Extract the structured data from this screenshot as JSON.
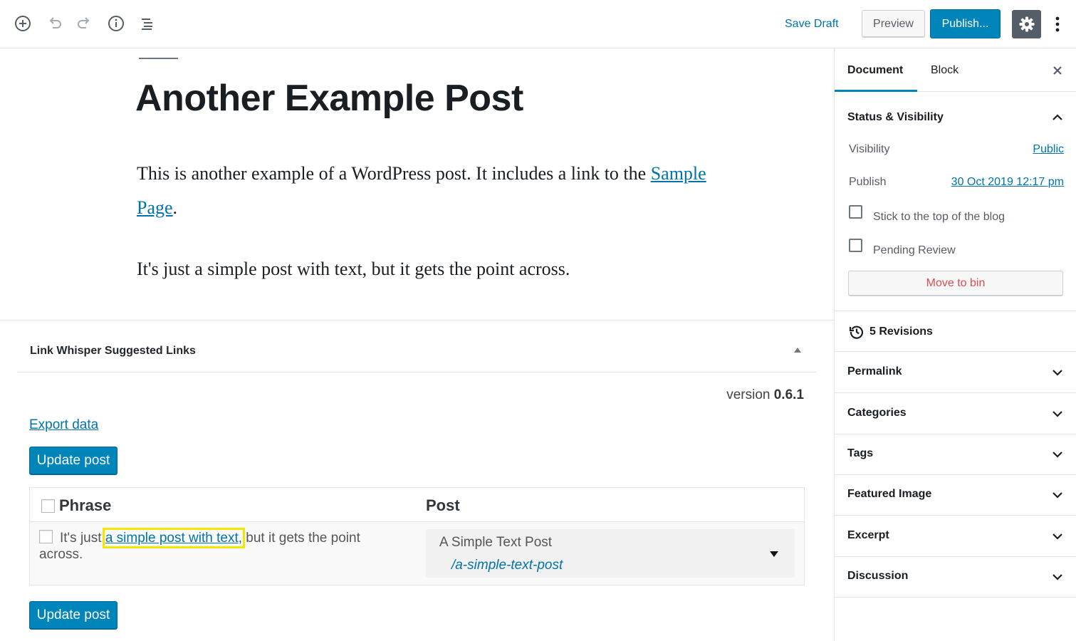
{
  "toolbar": {
    "save_draft": "Save Draft",
    "preview": "Preview",
    "publish": "Publish...",
    "icons": [
      "add-block-icon",
      "undo-icon",
      "redo-icon",
      "info-icon",
      "block-navigation-icon",
      "gear-icon",
      "more-menu-icon"
    ]
  },
  "editor": {
    "title": "Another Example Post",
    "para1_before": "This is another example of a WordPress post. It includes a link to the ",
    "para1_link": "Sample Page",
    "para1_after": ".",
    "para2": "It's just a simple post with text, but it gets the point across."
  },
  "link_whisper": {
    "title": "Link Whisper Suggested Links",
    "version_label": "version ",
    "version_number": "0.6.1",
    "export": "Export data",
    "update_button": "Update post",
    "columns": {
      "phrase": "Phrase",
      "post": "Post"
    },
    "row": {
      "before": "It's just ",
      "link": "a simple post with text,",
      "after": " but it gets the point across.",
      "post_title": "A Simple Text Post",
      "post_slug": "/a-simple-text-post"
    }
  },
  "sidebar": {
    "tabs": {
      "document": "Document",
      "block": "Block"
    },
    "status": {
      "title": "Status & Visibility",
      "visibility_label": "Visibility",
      "visibility_value": "Public",
      "publish_label": "Publish",
      "publish_value": "30 Oct 2019 12:17 pm",
      "stick_label": "Stick to the top of the blog",
      "pending_label": "Pending Review",
      "bin_button": "Move to bin"
    },
    "revisions": "5 Revisions",
    "sections": [
      "Permalink",
      "Categories",
      "Tags",
      "Featured Image",
      "Excerpt",
      "Discussion"
    ]
  },
  "colors": {
    "accent": "#0085ba",
    "link": "#0073aa",
    "highlight": "#f5e500",
    "danger": "#d94f4f"
  }
}
